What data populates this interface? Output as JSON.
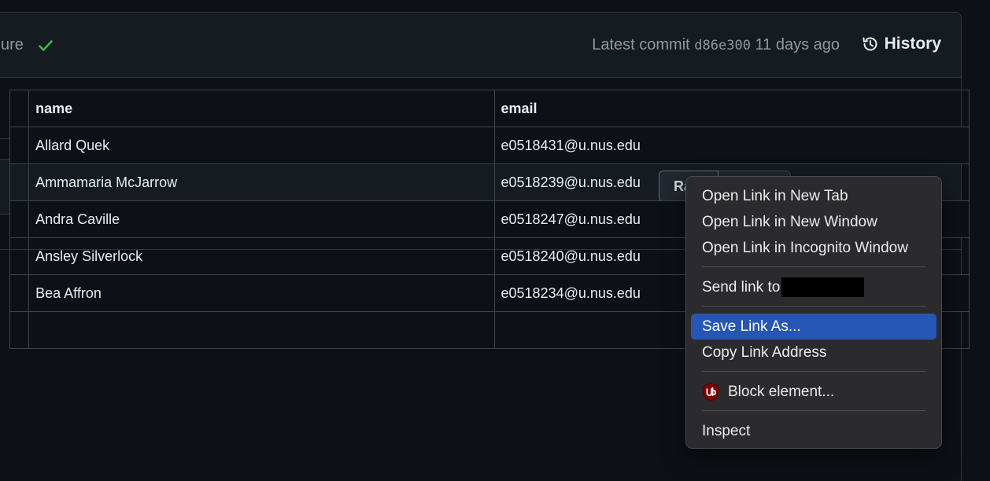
{
  "commit": {
    "message_tail": "ure",
    "latest_label": "Latest commit",
    "sha": "d86e300",
    "age": "11 days ago",
    "history_label": "History",
    "check_color": "#3fb950"
  },
  "file_toolbar": {
    "raw_label": "Ra"
  },
  "table": {
    "headers": [
      "",
      "name",
      "email"
    ],
    "rows": [
      {
        "name": "Allard Quek",
        "email": "e0518431@u.nus.edu"
      },
      {
        "name": "Ammamaria McJarrow",
        "email": "e0518239@u.nus.edu"
      },
      {
        "name": "Andra Caville",
        "email": "e0518247@u.nus.edu"
      },
      {
        "name": "Ansley Silverlock",
        "email": "e0518240@u.nus.edu"
      },
      {
        "name": "Bea Affron",
        "email": "e0518234@u.nus.edu"
      }
    ]
  },
  "context_menu": {
    "items": [
      {
        "label": "Open Link in New Tab"
      },
      {
        "label": "Open Link in New Window"
      },
      {
        "label": "Open Link in Incognito Window"
      },
      {
        "label": "Send link to"
      },
      {
        "label": "Save Link As..."
      },
      {
        "label": "Copy Link Address"
      },
      {
        "label": "Block element...",
        "icon": "ublock-origin-icon"
      },
      {
        "label": "Inspect"
      }
    ],
    "highlight_color": "#2656b5"
  }
}
